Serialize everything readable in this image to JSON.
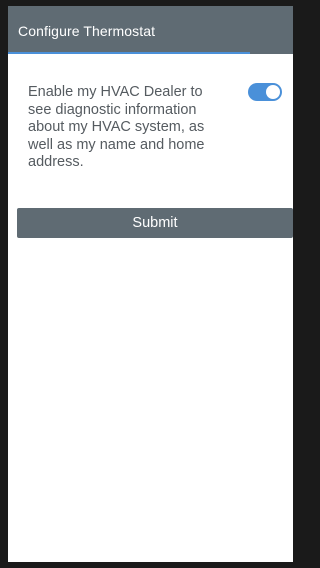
{
  "header": {
    "title": "Configure Thermostat",
    "progress": 0.85,
    "background_color": "#5f6b73",
    "progress_color": "#4a90d9"
  },
  "consent": {
    "text": "Enable my HVAC Dealer to see diagnostic information about my HVAC system, as well as my name and home address.",
    "toggle_enabled": true,
    "toggle_color": "#4a90d9"
  },
  "actions": {
    "submit_label": "Submit",
    "submit_color": "#5f6b73"
  }
}
